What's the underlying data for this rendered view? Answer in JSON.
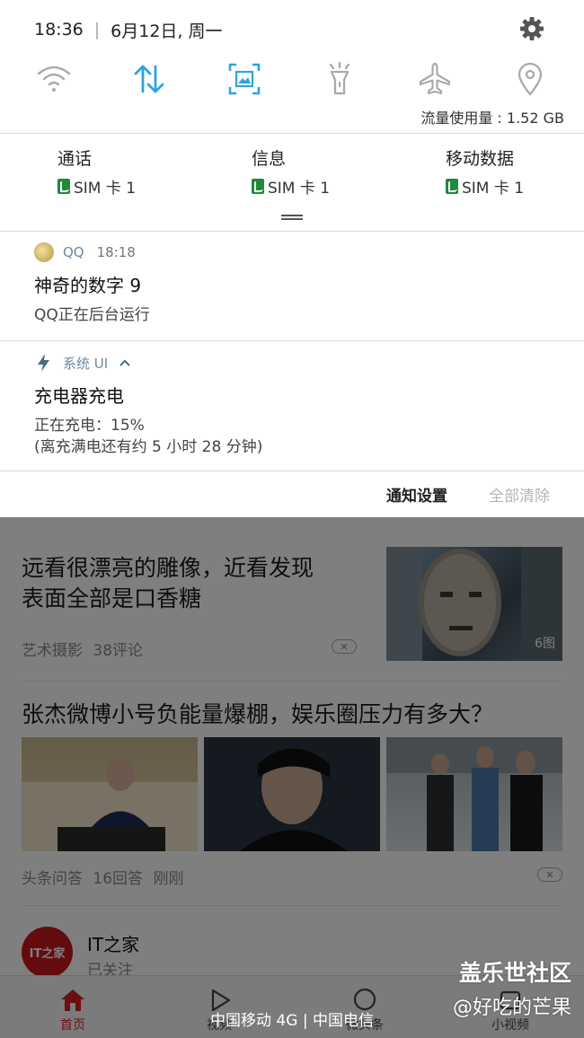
{
  "status": {
    "time": "18:36",
    "separator": "|",
    "date": "6月12日, 周一"
  },
  "quick_settings": [
    {
      "icon": "wifi-icon",
      "active": false
    },
    {
      "icon": "mobile-data-icon",
      "active": true
    },
    {
      "icon": "screenshot-icon",
      "active": true
    },
    {
      "icon": "flashlight-icon",
      "active": false
    },
    {
      "icon": "airplane-icon",
      "active": false
    },
    {
      "icon": "location-icon",
      "active": false
    }
  ],
  "data_usage": "流量使用量 : 1.52 GB",
  "sim_settings": [
    {
      "title": "通话",
      "sim": "SIM 卡 1"
    },
    {
      "title": "信息",
      "sim": "SIM 卡 1"
    },
    {
      "title": "移动数据",
      "sim": "SIM 卡 1"
    }
  ],
  "notifications": {
    "qq": {
      "app": "QQ",
      "time": "18:18",
      "title": "神奇的数字 9",
      "text": "QQ正在后台运行"
    },
    "system_ui": {
      "app": "系统 UI",
      "title": "充电器充电",
      "line1": "正在充电：15%",
      "line2": "(离充满电还有约 5 小时 28 分钟)"
    }
  },
  "actions": {
    "settings": "通知设置",
    "clear_all": "全部清除"
  },
  "feed": {
    "article1": {
      "title_line1": "远看很漂亮的雕像，近看发现",
      "title_line2": "表面全部是口香糖",
      "source": "艺术摄影",
      "comments": "38评论",
      "image_count": "6图"
    },
    "article2": {
      "title": "张杰微博小号负能量爆棚，娱乐圈压力有多大？",
      "source": "头条问答",
      "answers": "16回答",
      "time": "刚刚"
    },
    "account": {
      "logo": "IT之家",
      "name": "IT之家",
      "status": "已关注"
    },
    "dismiss": "✕"
  },
  "tabbar": {
    "home": "首页",
    "video": "视频",
    "micro": "微头条",
    "small_video": "小视频"
  },
  "carrier": "中国移动 4G | 中国电信",
  "watermark": {
    "line1": "盖乐世社区",
    "line2": "@好吃的芒果"
  },
  "colors": {
    "accent": "#2aa5e0",
    "red": "#d22222",
    "sim_green": "#1f8a3a"
  }
}
